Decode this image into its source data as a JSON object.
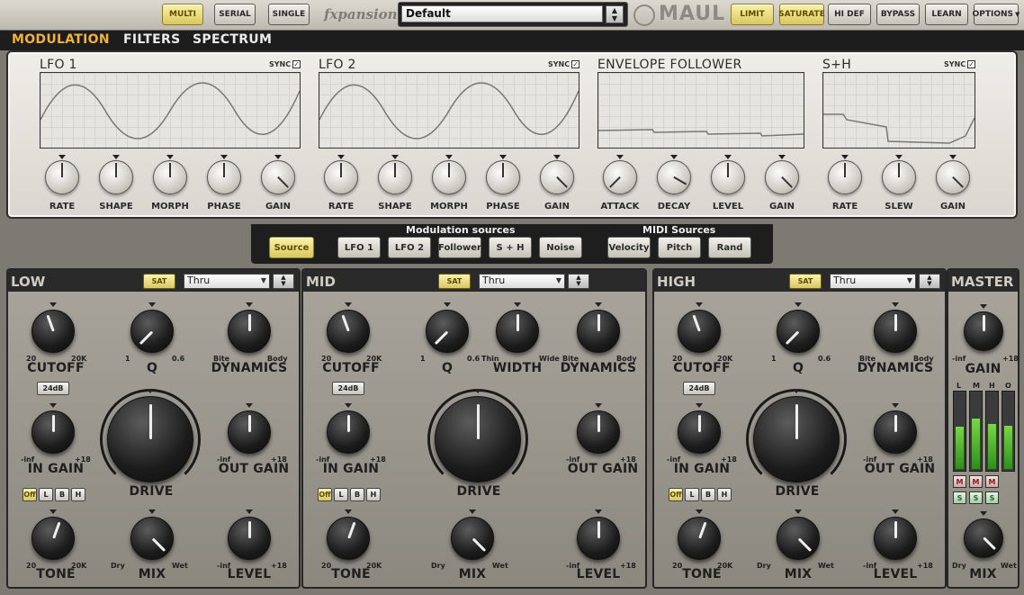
{
  "topbar": {
    "routing": [
      {
        "label": "MULTI",
        "active": true
      },
      {
        "label": "SERIAL",
        "active": false
      },
      {
        "label": "SINGLE",
        "active": false
      }
    ],
    "brand": "fxpansion",
    "preset": "Default",
    "product": "MAUL",
    "buttons": [
      {
        "label": "LIMIT",
        "active": true
      },
      {
        "label": "SATURATE",
        "active": true
      },
      {
        "label": "HI DEF",
        "active": false
      },
      {
        "label": "BYPASS",
        "active": false
      },
      {
        "label": "LEARN",
        "active": false
      },
      {
        "label": "OPTIONS",
        "active": false
      }
    ]
  },
  "tabs": [
    "MODULATION",
    "FILTERS",
    "SPECTRUM"
  ],
  "modulation": {
    "sync_label": "SYNC",
    "lfo1": {
      "title": "LFO 1",
      "knobs": [
        "RATE",
        "SHAPE",
        "MORPH",
        "PHASE",
        "GAIN"
      ]
    },
    "lfo2": {
      "title": "LFO 2",
      "knobs": [
        "RATE",
        "SHAPE",
        "MORPH",
        "PHASE",
        "GAIN"
      ]
    },
    "env": {
      "title": "ENVELOPE FOLLOWER",
      "knobs": [
        "ATTACK",
        "DECAY",
        "LEVEL",
        "GAIN"
      ]
    },
    "sh": {
      "title": "S+H",
      "knobs": [
        "RATE",
        "SLEW",
        "GAIN"
      ]
    }
  },
  "sources": {
    "mod_label": "Modulation sources",
    "midi_label": "MIDI Sources",
    "source_btn": "Source",
    "mod_buttons": [
      "LFO 1",
      "LFO 2",
      "Follower",
      "S + H",
      "Noise"
    ],
    "midi_buttons": [
      "Velocity",
      "Pitch",
      "Rand"
    ]
  },
  "bands": {
    "low": {
      "title": "LOW",
      "sat": "SAT",
      "mode": "Thru"
    },
    "mid": {
      "title": "MID",
      "sat": "SAT",
      "mode": "Thru"
    },
    "high": {
      "title": "HIGH",
      "sat": "SAT",
      "mode": "Thru"
    },
    "labels": {
      "cutoff": "CUTOFF",
      "q": "Q",
      "width": "WIDTH",
      "dynamics": "DYNAMICS",
      "in_gain": "IN GAIN",
      "out_gain": "OUT GAIN",
      "drive": "DRIVE",
      "tone": "TONE",
      "mix": "MIX",
      "level": "LEVEL",
      "slope": "24dB",
      "r20": "20",
      "r20k": "20K",
      "q_min": "1",
      "q_max": "0.6",
      "bite": "Bite",
      "body": "Body",
      "thin": "Thin",
      "wide": "Wide",
      "ninf": "-inf",
      "p18": "+18",
      "dry": "Dry",
      "wet": "Wet"
    },
    "solo_buttons": [
      "Off",
      "L",
      "B",
      "H"
    ]
  },
  "master": {
    "title": "MASTER",
    "gain": "GAIN",
    "mix": "MIX",
    "ninf": "-inf",
    "p18": "+18",
    "dry": "Dry",
    "wet": "Wet",
    "meters": [
      {
        "label": "L",
        "level": 0.55
      },
      {
        "label": "M",
        "level": 0.65
      },
      {
        "label": "H",
        "level": 0.58
      },
      {
        "label": "O",
        "level": 0.56
      }
    ],
    "mute": "M",
    "solo": "S"
  },
  "colors": {
    "accent": "#f2b13a",
    "on_button": "#f0e08a",
    "meter_green": "#4fb531"
  }
}
